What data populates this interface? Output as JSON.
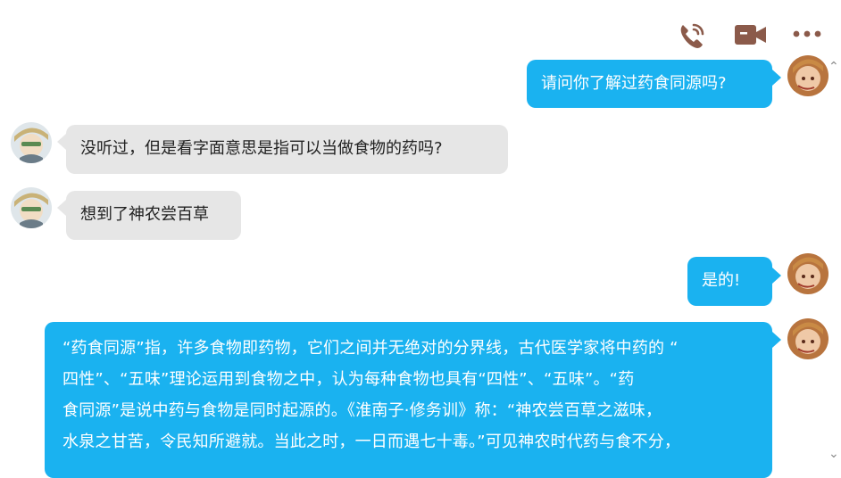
{
  "header": {
    "phone_icon": "phone-icon",
    "video_icon": "video-camera-icon",
    "more_icon": "more-dots-icon",
    "icon_color": "#8b5a4a"
  },
  "messages": [
    {
      "side": "right",
      "text": "请问你了解过药食同源吗?"
    },
    {
      "side": "left",
      "text": "没听过，但是看字面意思是指可以当做食物的药吗?"
    },
    {
      "side": "left",
      "text": "想到了神农尝百草"
    },
    {
      "side": "right",
      "text": "是的!"
    },
    {
      "side": "right",
      "lines": [
        "“药食同源”指，许多食物即药物，它们之间并无绝对的分界线，古代医学家将中药的 “",
        "四性”、“五味”理论运用到食物之中，认为每种食物也具有“四性”、“五味”。“药",
        "食同源”是说中药与食物是同时起源的。《淮南子·修务训》称：“神农尝百草之滋味，",
        "水泉之甘苦，令民知所避就。当此之时，一日而遇七十毒。”可见神农时代药与食不分，"
      ]
    }
  ],
  "colors": {
    "sent_bubble": "#1ab2f0",
    "received_bubble": "#e6e6e6"
  },
  "scroll": {
    "up_icon": "scroll-up-icon",
    "down_icon": "scroll-down-icon"
  }
}
